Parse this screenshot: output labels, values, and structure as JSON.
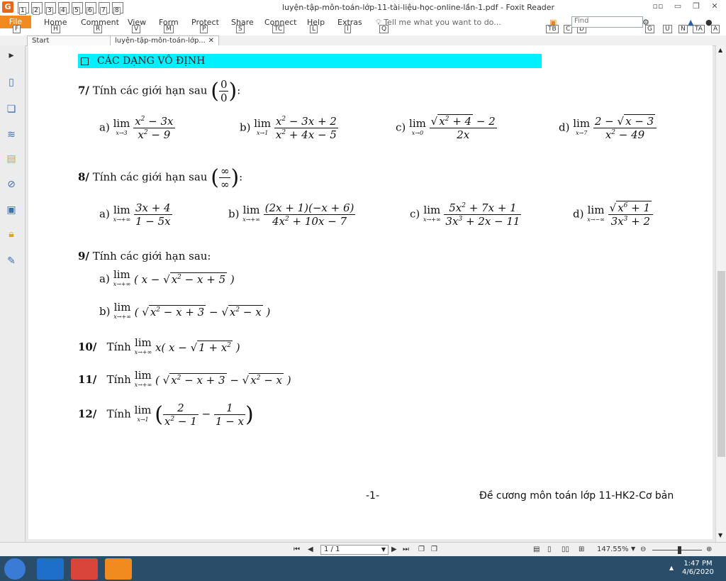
{
  "window": {
    "title": "luyện-tập-môn-toán-lớp-11-tài-liệu-học-online-lần-1.pdf - Foxit Reader",
    "app_logo": "G",
    "quick_access_keys": [
      "1",
      "2",
      "3",
      "4",
      "5",
      "6",
      "7",
      "8"
    ]
  },
  "ribbon": {
    "tabs": [
      {
        "label": "File",
        "key": "F"
      },
      {
        "label": "Home",
        "key": "H"
      },
      {
        "label": "Comment",
        "key": "R"
      },
      {
        "label": "View",
        "key": "V"
      },
      {
        "label": "Form",
        "key": "M"
      },
      {
        "label": "Protect",
        "key": "P"
      },
      {
        "label": "Share",
        "key": "S"
      },
      {
        "label": "Connect",
        "key": "TC"
      },
      {
        "label": "Help",
        "key": "L"
      },
      {
        "label": "Extras",
        "key": "I"
      }
    ],
    "tell_me": "Tell me what you want to do...",
    "tell_me_key": "Q",
    "find_placeholder": "Find",
    "right_keys": [
      "TB",
      "C",
      "D",
      "G",
      "U",
      "N",
      "TA",
      "A"
    ]
  },
  "doc_tabs": [
    {
      "label": "Start"
    },
    {
      "label": "luyện-tập-môn-toán-lớp..."
    }
  ],
  "page": {
    "section_title": "CÁC DẠNG VÔ ĐỊNH",
    "q7": {
      "num": "7/",
      "text": "Tính các giới hạn sau",
      "form_num": "0",
      "form_den": "0",
      "colon": ":"
    },
    "q8": {
      "num": "8/",
      "text": "Tính các giới hạn sau",
      "form_num": "∞",
      "form_den": "∞",
      "colon": ":"
    },
    "q9": {
      "num": "9/",
      "text": "Tính các giới hạn sau:"
    },
    "q10": {
      "num": "10/",
      "text": "Tính"
    },
    "q11": {
      "num": "11/",
      "text": "Tính"
    },
    "q12": {
      "num": "12/",
      "text": "Tính"
    },
    "labels": {
      "a": "a)",
      "b": "b)",
      "c": "c)",
      "d": "d)"
    },
    "lim_word": "lim",
    "footer_page": "-1-",
    "footer_title": "Đề cương môn toán lớp 11-HK2-Cơ bản"
  },
  "status": {
    "page_value": "1 / 1",
    "zoom": "147.55%"
  },
  "taskbar": {
    "time": "1:47 PM",
    "date": "4/6/2020"
  }
}
